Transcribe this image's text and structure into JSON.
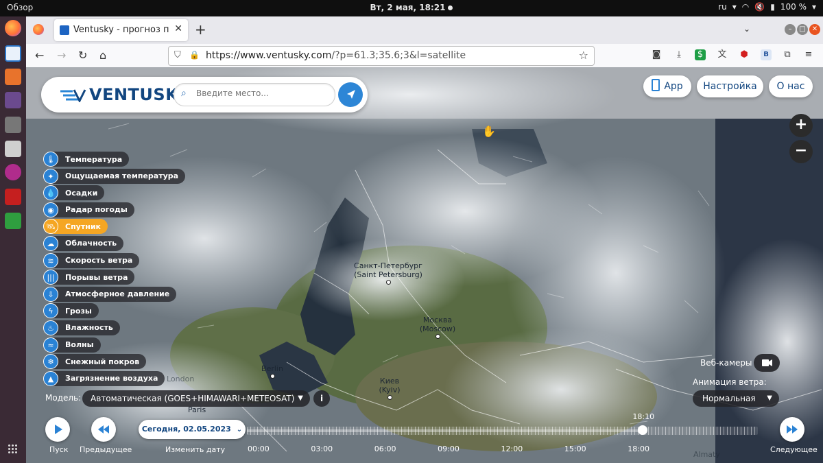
{
  "system": {
    "overview": "Обзор",
    "datetime": "Вт, 2 мая, 18:21",
    "lang": "ru",
    "battery": "100 %"
  },
  "browser": {
    "tab_title": "Ventusky - прогноз погоды",
    "url_base": "https://www.ventusky.com",
    "url_rest": "/?p=61.3;35.6;3&l=satellite"
  },
  "app": {
    "logo": "VENTUSKY",
    "search_placeholder": "Введите место...",
    "top_buttons": {
      "app": "App",
      "settings": "Настройка",
      "about": "О нас"
    },
    "zoom": {
      "in": "+",
      "out": "−"
    },
    "layers": [
      {
        "label": "Температура",
        "icon": "thermometer-icon",
        "glyph": "🌡",
        "active": false
      },
      {
        "label": "Ощущаемая температура",
        "icon": "feels-like-icon",
        "glyph": "✦",
        "active": false
      },
      {
        "label": "Осадки",
        "icon": "drop-icon",
        "glyph": "💧",
        "active": false
      },
      {
        "label": "Радар погоды",
        "icon": "radar-icon",
        "glyph": "◉",
        "active": false
      },
      {
        "label": "Спутник",
        "icon": "satellite-icon",
        "glyph": "🛰",
        "active": true
      },
      {
        "label": "Облачность",
        "icon": "cloud-icon",
        "glyph": "☁",
        "active": false
      },
      {
        "label": "Скорость ветра",
        "icon": "wind-icon",
        "glyph": "≋",
        "active": false
      },
      {
        "label": "Порывы ветра",
        "icon": "gusts-icon",
        "glyph": "|||",
        "active": false
      },
      {
        "label": "Атмосферное давление",
        "icon": "pressure-icon",
        "glyph": "⇩",
        "active": false
      },
      {
        "label": "Грозы",
        "icon": "lightning-icon",
        "glyph": "ϟ",
        "active": false
      },
      {
        "label": "Влажность",
        "icon": "humidity-icon",
        "glyph": "♨",
        "active": false
      },
      {
        "label": "Волны",
        "icon": "waves-icon",
        "glyph": "≈",
        "active": false
      },
      {
        "label": "Снежный покров",
        "icon": "snowflake-icon",
        "glyph": "❄",
        "active": false
      },
      {
        "label": "Загрязнение воздуха",
        "icon": "factory-icon",
        "glyph": "▲",
        "active": false
      }
    ],
    "model_label": "Модель:",
    "model_value": "Автоматическая (GOES+HIMAWARI+METEOSAT)",
    "info": "i",
    "webcams": "Веб-камеры",
    "wind_anim_label": "Анимация ветра:",
    "wind_anim_value": "Нормальная",
    "controls": {
      "play": "Пуск",
      "prev": "Предыдущее",
      "date": "Сегодня, 02.05.2023",
      "change_date": "Изменить дату",
      "next": "Следующее"
    },
    "current_time": "18:10",
    "current_time_fraction": 0.775,
    "time_labels": [
      "00:00",
      "03:00",
      "06:00",
      "09:00",
      "12:00",
      "15:00",
      "18:00"
    ],
    "cities": {
      "spb_ru": "Санкт-Петербург",
      "spb_en": "(Saint Petersburg)",
      "msk_ru": "Москва",
      "msk_en": "(Moscow)",
      "berlin": "Berlin",
      "kyiv_ru": "Киев",
      "kyiv_en": "(Kyiv)",
      "paris": "Paris",
      "london": "London",
      "almaty": "Almaty"
    }
  }
}
